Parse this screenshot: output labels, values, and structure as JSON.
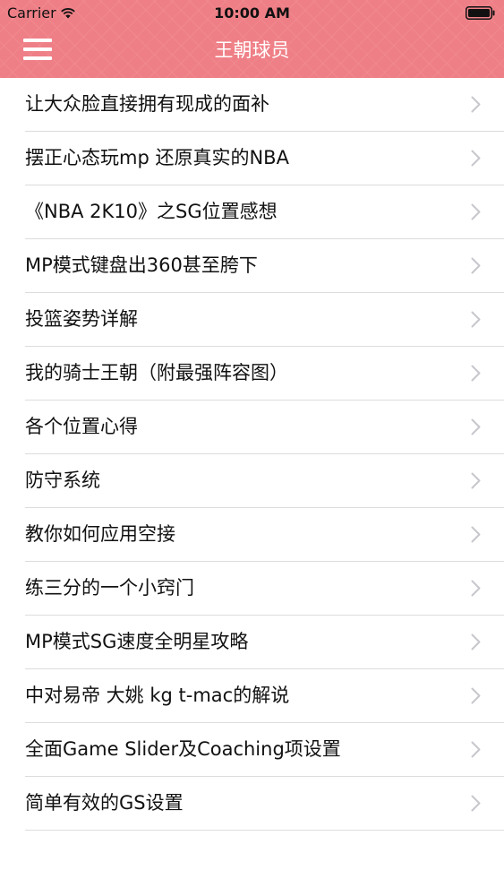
{
  "status_bar": {
    "carrier": "Carrier",
    "time": "10:00 AM",
    "wifi_icon": "wifi-icon",
    "battery_icon": "battery-icon"
  },
  "nav_bar": {
    "title": "王朝球员",
    "menu_icon": "hamburger-menu-icon",
    "background_color": "#ef7f86"
  },
  "list": {
    "chevron_icon": "chevron-right-icon",
    "items": [
      {
        "label": "让大众脸直接拥有现成的面补"
      },
      {
        "label": "摆正心态玩mp 还原真实的NBA"
      },
      {
        "label": "《NBA 2K10》之SG位置感想"
      },
      {
        "label": "MP模式键盘出360甚至胯下"
      },
      {
        "label": "投篮姿势详解"
      },
      {
        "label": "我的骑士王朝（附最强阵容图）"
      },
      {
        "label": "各个位置心得"
      },
      {
        "label": "防守系统"
      },
      {
        "label": "教你如何应用空接"
      },
      {
        "label": "练三分的一个小窍门"
      },
      {
        "label": "MP模式SG速度全明星攻略"
      },
      {
        "label": "中对易帝 大姚 kg t-mac的解说"
      },
      {
        "label": "全面Game Slider及Coaching项设置"
      },
      {
        "label": "简单有效的GS设置"
      }
    ]
  }
}
